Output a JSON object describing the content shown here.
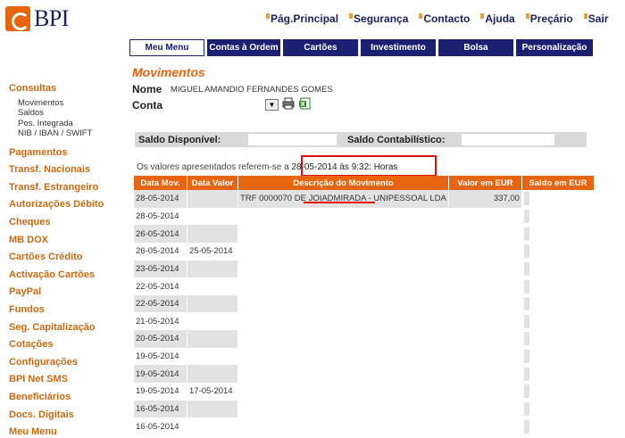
{
  "brand": {
    "name": "BPI",
    "color": "#e8650f"
  },
  "top_links": [
    "Pág.Principal",
    "Segurança",
    "Contacto",
    "Ajuda",
    "Preçário",
    "Sair"
  ],
  "tabs": [
    {
      "label": "Meu Menu",
      "active": true
    },
    {
      "label": "Contas à Ordem",
      "active": false
    },
    {
      "label": "Cartões",
      "active": false
    },
    {
      "label": "Investimento",
      "active": false
    },
    {
      "label": "Bolsa",
      "active": false
    },
    {
      "label": "Personalização",
      "active": false
    }
  ],
  "sidebar": {
    "consultas": {
      "label": "Consultas",
      "items": [
        "Movimentos",
        "Saldos",
        "Pos. Integrada",
        "NIB / IBAN / SWIFT"
      ]
    },
    "sections": [
      "Pagamentos",
      "Transf. Nacionais",
      "Transf. Estrangeiro",
      "Autorizações Débito",
      "Cheques",
      "MB DOX",
      "Cartões Crédito",
      "Activação Cartões",
      "PayPal",
      "Fundos",
      "Seg. Capitalização",
      "Cotações",
      "Configurações",
      "BPI Net SMS",
      "Beneficiários",
      "Docs. Digitais",
      "Meu Menu"
    ]
  },
  "main": {
    "title": "Movimentos",
    "nome_label": "Nome",
    "nome_value": "MIGUEL AMANDIO FERNANDES GOMES",
    "conta_label": "Conta",
    "select_arrow": "▼",
    "saldo_disponivel_label": "Saldo Disponível:",
    "saldo_contabilistico_label": "Saldo Contabilístico:",
    "note_prefix": "Os valores apresentados referem-se a",
    "note_date": "28-05-2014 às 9:32: Horas"
  },
  "table": {
    "headers": [
      "Data Mov.",
      "Data Valor",
      "Descrição do Movimento",
      "Valor em  EUR",
      "Saldo em  EUR"
    ],
    "rows": [
      {
        "date": "28-05-2014",
        "value_date": "",
        "desc": "TRF 0000070 DE JOIADMIRADA - UNIPESSOAL LDA",
        "value": "337,00"
      },
      {
        "date": "28-05-2014",
        "value_date": "",
        "desc": "",
        "value": ""
      },
      {
        "date": "26-05-2014",
        "value_date": "",
        "desc": "",
        "value": ""
      },
      {
        "date": "26-05-2014",
        "value_date": "25-05-2014",
        "desc": "",
        "value": ""
      },
      {
        "date": "23-05-2014",
        "value_date": "",
        "desc": "",
        "value": ""
      },
      {
        "date": "22-05-2014",
        "value_date": "",
        "desc": "",
        "value": ""
      },
      {
        "date": "22-05-2014",
        "value_date": "",
        "desc": "",
        "value": ""
      },
      {
        "date": "21-05-2014",
        "value_date": "",
        "desc": "",
        "value": ""
      },
      {
        "date": "20-05-2014",
        "value_date": "",
        "desc": "",
        "value": ""
      },
      {
        "date": "19-05-2014",
        "value_date": "",
        "desc": "",
        "value": ""
      },
      {
        "date": "19-05-2014",
        "value_date": "",
        "desc": "",
        "value": ""
      },
      {
        "date": "19-05-2014",
        "value_date": "17-05-2014",
        "desc": "",
        "value": ""
      },
      {
        "date": "16-05-2014",
        "value_date": "",
        "desc": "",
        "value": ""
      },
      {
        "date": "16-05-2014",
        "value_date": "",
        "desc": "",
        "value": ""
      }
    ]
  }
}
